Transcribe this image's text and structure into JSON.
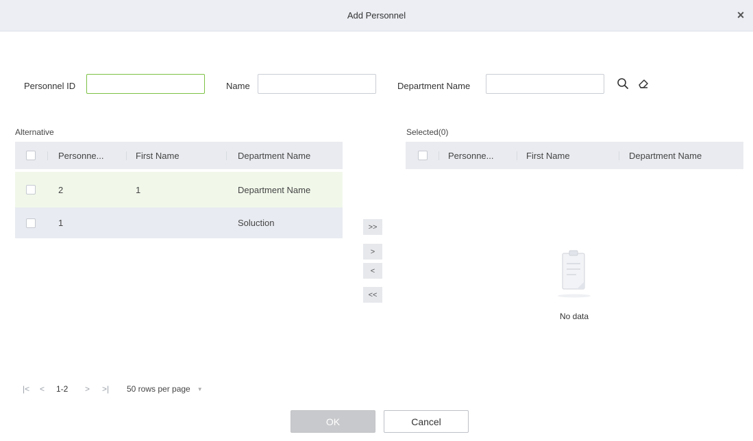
{
  "dialog": {
    "title": "Add Personnel",
    "close_symbol": "×"
  },
  "filters": {
    "personnel_id_label": "Personnel ID",
    "personnel_id_value": "",
    "name_label": "Name",
    "name_value": "",
    "department_label": "Department Name",
    "department_value": ""
  },
  "icons": {
    "search": "search-icon",
    "clear": "eraser-icon",
    "empty": "clipboard-icon"
  },
  "alternative": {
    "label": "Alternative",
    "columns": [
      "Personne...",
      "First Name",
      "Department Name"
    ],
    "rows": [
      {
        "id": "2",
        "first_name": "1",
        "department": "Department Name"
      },
      {
        "id": "1",
        "first_name": "",
        "department": "Soluction"
      }
    ]
  },
  "transfer": {
    "move_all_right": ">>",
    "move_right": ">",
    "move_left": "<",
    "move_all_left": "<<"
  },
  "selected": {
    "label": "Selected(0)",
    "columns": [
      "Personne...",
      "First Name",
      "Department Name"
    ],
    "empty_text": "No data"
  },
  "pager": {
    "first": "|<",
    "prev": "<",
    "range": "1-2",
    "next": ">",
    "last": ">|",
    "rows_per_page": "50 rows per page",
    "dropdown": "▼"
  },
  "buttons": {
    "ok": "OK",
    "cancel": "Cancel"
  },
  "colors": {
    "accent_green": "#7ac143",
    "header_bg": "#e9ebf0",
    "row_highlight": "#f1f8ea",
    "row_selected": "#e8ebf1"
  }
}
